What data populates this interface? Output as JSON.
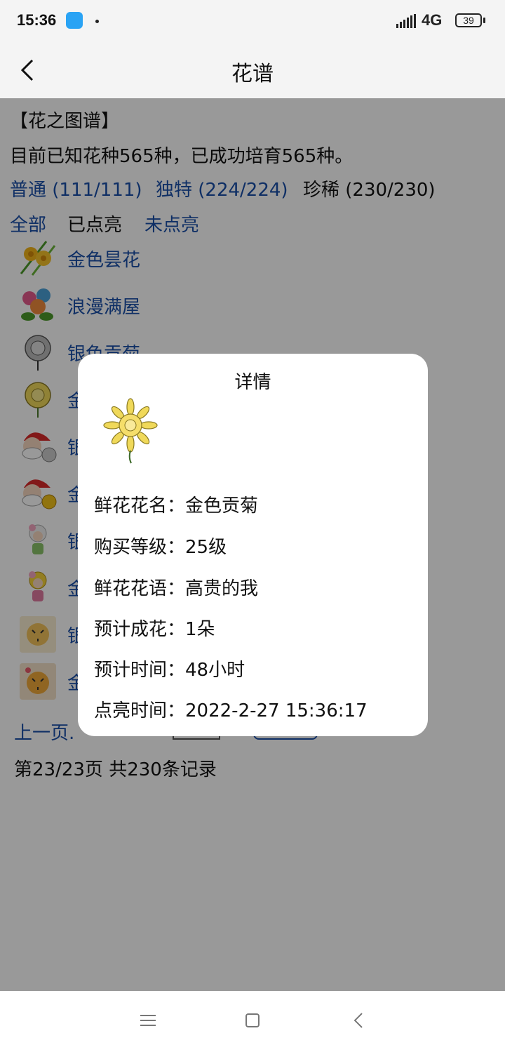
{
  "status_bar": {
    "time": "15:36",
    "network": "4G",
    "battery": "39"
  },
  "header": {
    "title": "花谱"
  },
  "page": {
    "section_title": "【花之图谱】",
    "summary": "目前已知花种565种，已成功培育565种。",
    "rarity_tabs": [
      {
        "label": "普通 (111/111)",
        "active": false
      },
      {
        "label": "独特 (224/224)",
        "active": false
      },
      {
        "label": "珍稀 (230/230)",
        "active": true
      }
    ],
    "filters": [
      {
        "label": "全部",
        "active": false
      },
      {
        "label": "已点亮",
        "active": true
      },
      {
        "label": "未点亮",
        "active": false
      }
    ],
    "flowers": [
      {
        "name": "金色昙花",
        "icon": "golden-epiphyllum-icon"
      },
      {
        "name": "浪漫满屋",
        "icon": "romantic-house-icon"
      },
      {
        "name": "银色贡菊",
        "icon": "silver-chrysanthemum-icon"
      },
      {
        "name": "金",
        "icon": "golden-chrysanthemum-icon"
      },
      {
        "name": "银",
        "icon": "santa-silver-icon"
      },
      {
        "name": "金",
        "icon": "santa-gold-icon"
      },
      {
        "name": "银",
        "icon": "fairy-silver-icon"
      },
      {
        "name": "金",
        "icon": "fairy-gold-icon"
      },
      {
        "name": "银",
        "icon": "tiger-silver-icon"
      },
      {
        "name": "金",
        "icon": "tiger-gold-icon"
      }
    ],
    "pager": {
      "prev": "上一页."
    },
    "page_info": "第23/23页 共230条记录"
  },
  "dialog": {
    "title": "详情",
    "flower_icon": "golden-chrysanthemum-icon",
    "rows": [
      {
        "label": "鲜花花名：",
        "value": "金色贡菊"
      },
      {
        "label": "购买等级：",
        "value": "25级"
      },
      {
        "label": "鲜花花语：",
        "value": "高贵的我"
      },
      {
        "label": "预计成花：",
        "value": "1朵"
      },
      {
        "label": "预计时间：",
        "value": "48小时"
      },
      {
        "label": "点亮时间：",
        "value": "2022-2-27 15:36:17"
      }
    ]
  },
  "colors": {
    "link": "#1a4fa8",
    "overlay": "rgba(0,0,0,0.4)",
    "header_bg": "#f4f4f4"
  }
}
